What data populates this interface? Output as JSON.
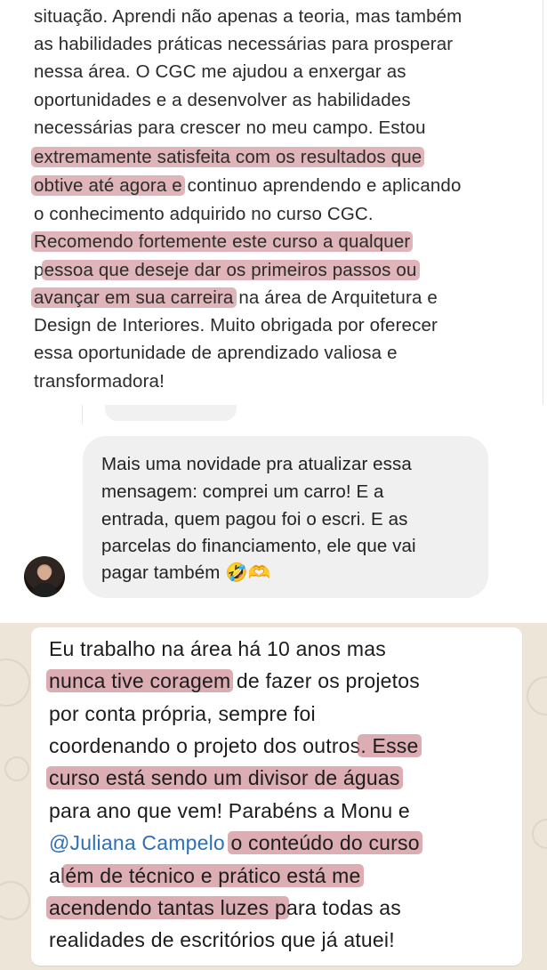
{
  "review": {
    "lines": [
      [
        {
          "t": "situação. Aprendi não apenas a teoria, mas também",
          "h": false
        }
      ],
      [
        {
          "t": "as habilidades práticas necessárias para prosperar",
          "h": false
        }
      ],
      [
        {
          "t": "nessa área. O CGC me ajudou a enxergar as",
          "h": false
        }
      ],
      [
        {
          "t": "oportunidades e a desenvolver as habilidades",
          "h": false
        }
      ],
      [
        {
          "t": "necessárias para crescer no meu campo. Estou",
          "h": false
        }
      ],
      [
        {
          "t": "extremamente satisfeita com os resultados que",
          "h": true
        }
      ],
      [
        {
          "t": "obtive até agora e",
          "h": true
        },
        {
          "t": " continuo aprendendo e aplicando",
          "h": false
        }
      ],
      [
        {
          "t": "o conhecimento adquirido no curso CGC.",
          "h": false
        }
      ],
      [
        {
          "t": "Recomendo fortemente este curso a qualquer",
          "h": true
        }
      ],
      [
        {
          "t": "p",
          "h": false
        },
        {
          "t": "essoa que deseje dar os primeiros passos ou",
          "h": true
        }
      ],
      [
        {
          "t": "avançar em sua carreira",
          "h": true
        },
        {
          "t": " na área de Arquitetura e",
          "h": false
        }
      ],
      [
        {
          "t": "Design de Interiores. Muito obrigada por oferecer",
          "h": false
        }
      ],
      [
        {
          "t": "essa oportunidade de aprendizado valiosa e",
          "h": false
        }
      ],
      [
        {
          "t": "transformadora!",
          "h": false
        }
      ]
    ]
  },
  "chat": {
    "lines": [
      "Mais uma novidade pra atualizar essa",
      "mensagem: comprei um carro! E a",
      "entrada, quem pagou foi o escri. E as",
      "parcelas do financiamento, ele que vai",
      "pagar também 🤣🫶"
    ]
  },
  "whatsapp": {
    "lines": [
      [
        {
          "t": "Eu trabalho na área há 10 anos mas",
          "h": false
        }
      ],
      [
        {
          "t": "nunca tive coragem",
          "h": true
        },
        {
          "t": " de fazer os projetos",
          "h": false
        }
      ],
      [
        {
          "t": "por conta própria, sempre foi",
          "h": false
        }
      ],
      [
        {
          "t": "coordenando o projeto dos outros",
          "h": false
        },
        {
          "t": ". Esse",
          "h": true
        }
      ],
      [
        {
          "t": "curso está sendo um divisor de águas",
          "h": true
        }
      ],
      [
        {
          "t": "para ano que vem! Parabéns a Monu e",
          "h": false
        }
      ],
      [
        {
          "t": "@Juliana Campelo",
          "h": false,
          "m": true
        },
        {
          "t": " ",
          "h": false
        },
        {
          "t": "o conteúdo do curso",
          "h": true
        }
      ],
      [
        {
          "t": "al",
          "h": false
        },
        {
          "t": "ém de técnico e prático está me",
          "h": true
        }
      ],
      [
        {
          "t": "acendendo tantas luzes p",
          "h": true
        },
        {
          "t": "ara todas as",
          "h": false
        }
      ],
      [
        {
          "t": "realidades de escritórios que já atuei!",
          "h": false
        }
      ]
    ]
  }
}
